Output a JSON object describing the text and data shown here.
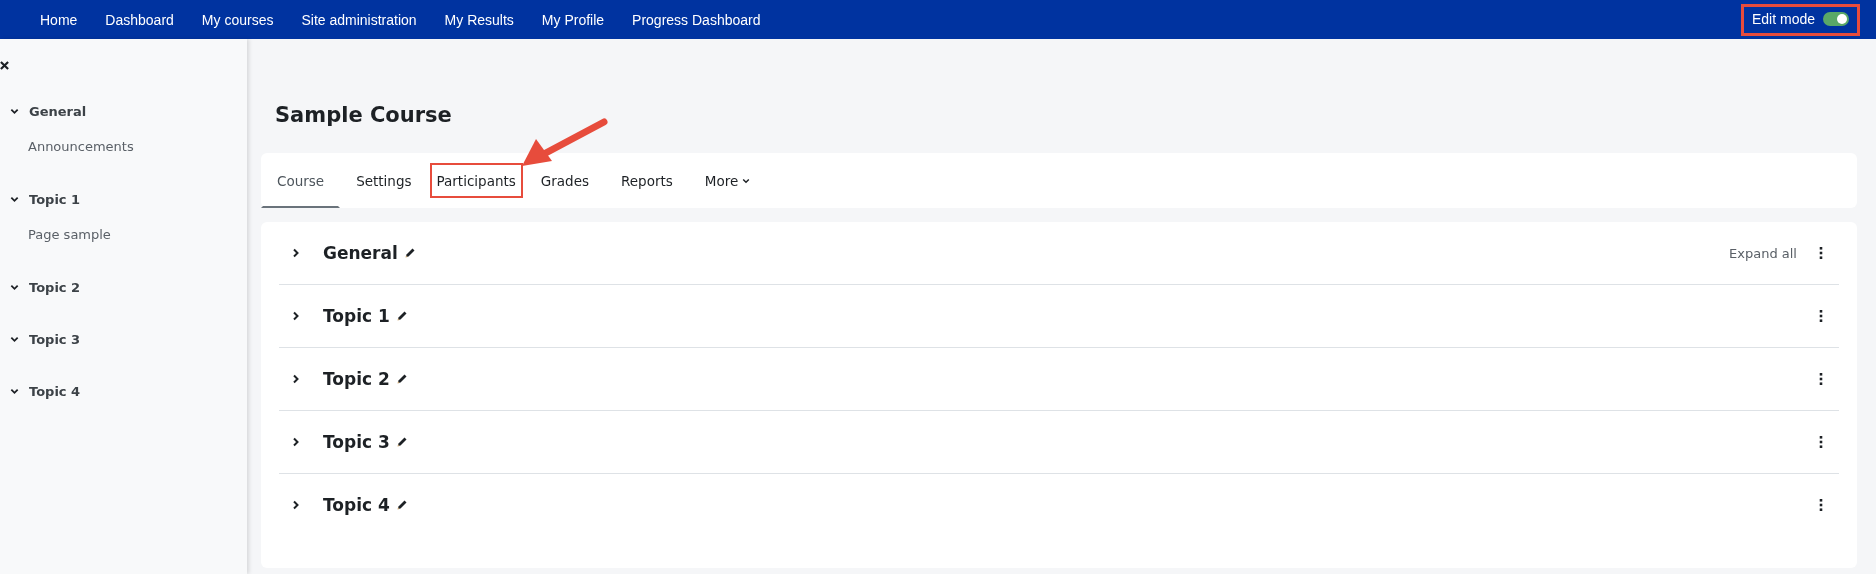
{
  "nav": [
    {
      "label": "Home"
    },
    {
      "label": "Dashboard"
    },
    {
      "label": "My courses"
    },
    {
      "label": "Site administration"
    },
    {
      "label": "My Results"
    },
    {
      "label": "My Profile"
    },
    {
      "label": "Progress Dashboard"
    }
  ],
  "edit_mode": {
    "label": "Edit mode",
    "on": true,
    "highlighted": true
  },
  "sidebar": {
    "items": [
      {
        "label": "General",
        "expanded": true,
        "children": [
          {
            "label": "Announcements"
          }
        ]
      },
      {
        "label": "Topic 1",
        "expanded": true,
        "children": [
          {
            "label": "Page sample"
          }
        ]
      },
      {
        "label": "Topic 2",
        "expanded": true
      },
      {
        "label": "Topic 3",
        "expanded": true
      },
      {
        "label": "Topic 4",
        "expanded": true
      }
    ]
  },
  "course_title": "Sample Course",
  "tabs": [
    {
      "label": "Course",
      "selected": true,
      "highlighted": false
    },
    {
      "label": "Settings",
      "selected": false,
      "highlighted": false
    },
    {
      "label": "Participants",
      "selected": false,
      "highlighted": true
    },
    {
      "label": "Grades",
      "selected": false,
      "highlighted": false
    },
    {
      "label": "Reports",
      "selected": false,
      "highlighted": false
    },
    {
      "label": "More",
      "selected": false,
      "highlighted": false,
      "kind": "dropdown"
    }
  ],
  "expand_all": "Expand all",
  "sections": [
    {
      "title": "General",
      "expanded": false
    },
    {
      "title": "Topic 1",
      "expanded": false
    },
    {
      "title": "Topic 2",
      "expanded": false
    },
    {
      "title": "Topic 3",
      "expanded": false
    },
    {
      "title": "Topic 4",
      "expanded": false
    }
  ]
}
